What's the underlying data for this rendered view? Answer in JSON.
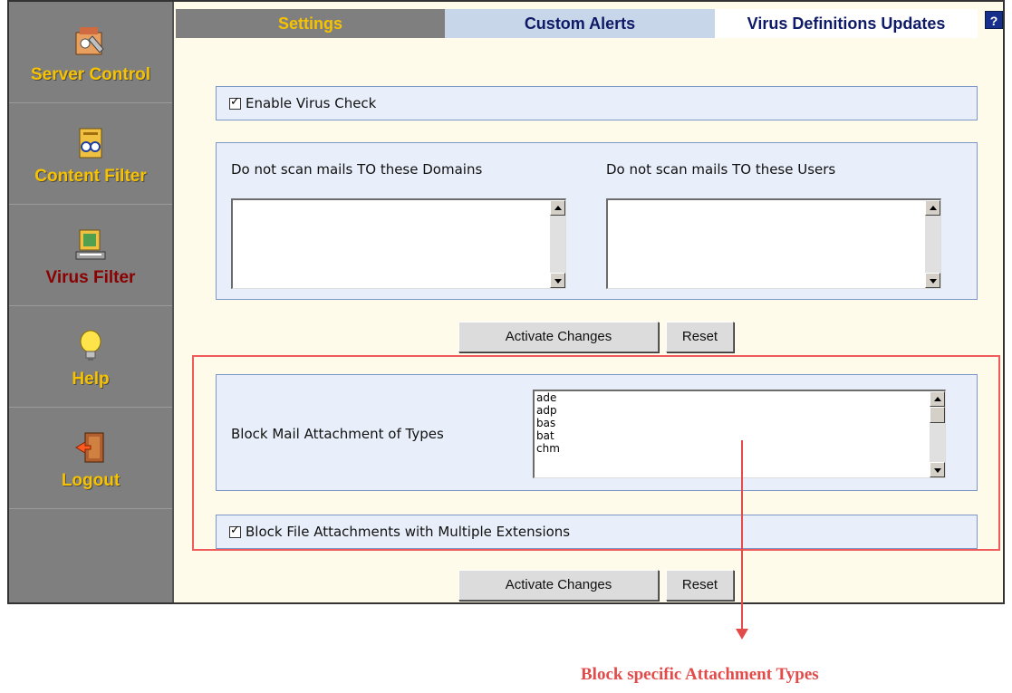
{
  "sidebar": {
    "items": [
      {
        "label": "Server Control",
        "icon": "server-control-icon"
      },
      {
        "label": "Content Filter",
        "icon": "content-filter-icon"
      },
      {
        "label": "Virus Filter",
        "icon": "virus-filter-icon",
        "active": true
      },
      {
        "label": "Help",
        "icon": "lightbulb-icon"
      },
      {
        "label": "Logout",
        "icon": "logout-door-icon"
      }
    ]
  },
  "tabs": [
    {
      "label": "Settings",
      "active": true
    },
    {
      "label": "Custom Alerts"
    },
    {
      "label": "Virus Definitions Updates"
    }
  ],
  "help_button": "?",
  "virus_check": {
    "label": "Enable Virus Check",
    "checked": true
  },
  "exclusions": {
    "domains_label": "Do not scan mails TO these Domains",
    "users_label": "Do not scan mails TO these Users"
  },
  "buttons": {
    "activate_label": "Activate Changes",
    "reset_label": "Reset"
  },
  "attachments": {
    "label": "Block Mail Attachment of Types",
    "types": [
      "ade",
      "adp",
      "bas",
      "bat",
      "chm"
    ]
  },
  "multi_ext": {
    "label": "Block File Attachments with Multiple Extensions",
    "checked": true
  },
  "annotation": {
    "text": "Block specific Attachment Types",
    "color": "#e34b4b"
  },
  "colors": {
    "sidebar": "#7f7f7f",
    "nav_label": "#f7c200",
    "nav_active": "#8b0000",
    "tab_text": "#0e1a66",
    "panel": "#e8effa"
  }
}
